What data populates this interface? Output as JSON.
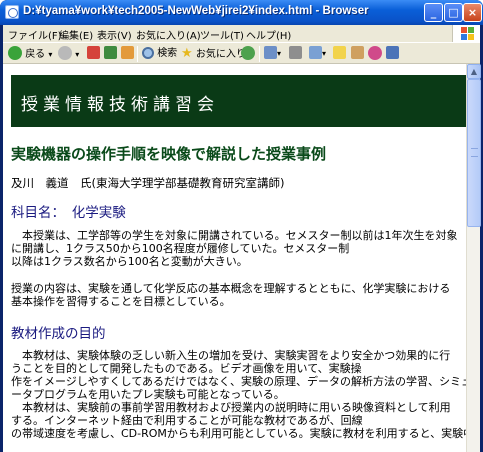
{
  "window": {
    "title": "D:¥tyama¥work¥tech2005-NewWeb¥jirei2¥index.html - Browser",
    "min_glyph": "_",
    "max_glyph": "□",
    "close_glyph": "×"
  },
  "menu": {
    "file": "ファイル(F)",
    "edit": "編集(E)",
    "view": "表示(V)",
    "favorites": "お気に入り(A)",
    "tools": "ツール(T)",
    "help": "ヘルプ(H)"
  },
  "toolbar": {
    "back_label": "戻る",
    "search_label": "検索",
    "favorites_label": "お気に入り"
  },
  "page": {
    "banner": "授業情報技術講習会",
    "heading": "実験機器の操作手順を映像で解説した授業事例",
    "author": "及川　義道　氏(東海大学理学部基礎教育研究室講師)",
    "subject": "科目名：　化学実験",
    "para1": [
      "　本授業は、工学部等の学生を対象に開講されている。セメスター制以前は1年次生を対象",
      "に開講し、1クラス50から100名程度が履修していた。セメスター制",
      "以降は1クラス数名から100名と変動が大きい。"
    ],
    "para2": [
      "授業の内容は、実験を通して化学反応の基本概念を理解するとともに、化学実験における",
      "基本操作を習得することを目標としている。"
    ],
    "section_title": "教材作成の目的",
    "para3": [
      "　本教材は、実験体験の乏しい新入生の増加を受け、実験実習をより安全かつ効果的に行",
      "うことを目的として開発したものである。ビデオ画像を用いて、実験操",
      "作をイメージしやすくしてあるだけではなく、実験の原理、データの解析方法の学習、シミュレ",
      "ータプログラムを用いたプレ実験も可能となっている。",
      "　本教材は、実験前の事前学習用教材および授業内の説明時に用いる映像資料として利用",
      "する。インターネット経由で利用することが可能な教材であるが、回線",
      "の帯域速度を考慮し、CD-ROMからも利用可能としている。実験に教材を利用すると、実験中"
    ]
  }
}
